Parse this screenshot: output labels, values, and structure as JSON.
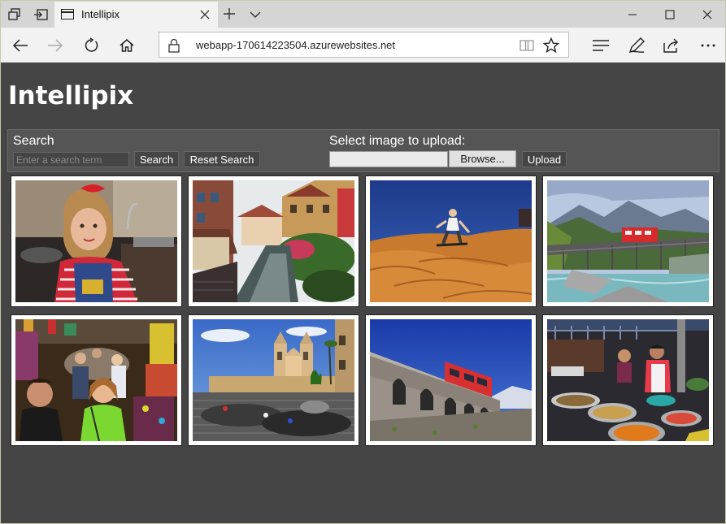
{
  "browser": {
    "tab_title": "Intellipix",
    "url": "webapp-170614223504.azurewebsites.net"
  },
  "app": {
    "title": "Intellipix"
  },
  "search": {
    "label": "Search",
    "placeholder": "Enter a search term",
    "search_button": "Search",
    "reset_button": "Reset Search"
  },
  "upload": {
    "label": "Select image to upload:",
    "browse_button": "Browse...",
    "upload_button": "Upload"
  },
  "gallery": {
    "images": [
      {
        "subject": "girl-in-kitchen"
      },
      {
        "subject": "canal-town"
      },
      {
        "subject": "sand-dune-sandboarder"
      },
      {
        "subject": "mountain-train-bridge"
      },
      {
        "subject": "market-street-crowd"
      },
      {
        "subject": "church-on-steps"
      },
      {
        "subject": "red-train-viaduct"
      },
      {
        "subject": "street-food-market"
      }
    ]
  },
  "colors": {
    "page_background": "#454545",
    "toolbar_background": "#555555",
    "title_text": "#ffffff"
  }
}
